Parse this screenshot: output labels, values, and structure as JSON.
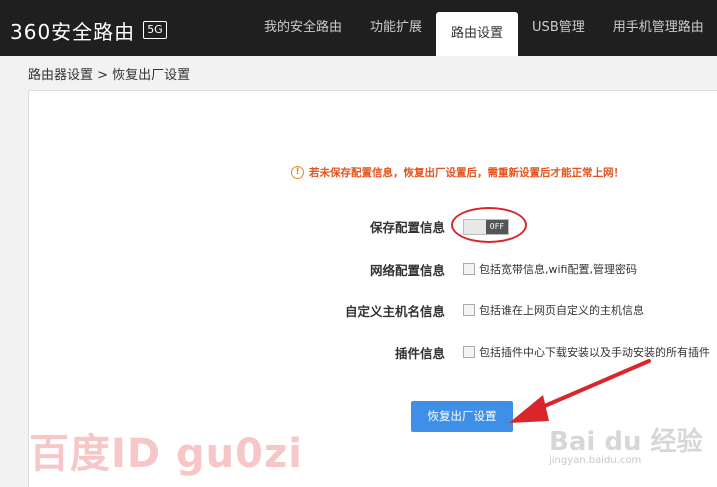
{
  "header": {
    "logo_text": "360安全路由",
    "logo_badge": "5G",
    "nav": [
      {
        "label": "我的安全路由"
      },
      {
        "label": "功能扩展"
      },
      {
        "label": "路由设置",
        "active": true
      },
      {
        "label": "USB管理"
      },
      {
        "label": "用手机管理路由"
      }
    ]
  },
  "breadcrumb": {
    "text": "路由器设置 > 恢复出厂设置"
  },
  "main": {
    "warning": "若未保存配置信息，恢复出厂设置后，需重新设置后才能正常上网！",
    "rows": [
      {
        "label": "保存配置信息",
        "toggle_state": "OFF"
      },
      {
        "label": "网络配置信息",
        "description": "包括宽带信息,wifi配置,管理密码",
        "checked": false
      },
      {
        "label": "自定义主机名信息",
        "description": "包括谁在上网页自定义的主机信息",
        "checked": false
      },
      {
        "label": "插件信息",
        "description": "包括插件中心下载安装以及手动安装的所有插件",
        "checked": false
      }
    ],
    "reset_button": "恢复出厂设置"
  },
  "watermarks": {
    "left": "百度ID gu0zi",
    "right": "Bai du 经验",
    "right_sub": "jingyan.baidu.com"
  },
  "colors": {
    "header_bg": "#1f1f1f",
    "warning": "#e4541d",
    "button": "#3d8fe8",
    "annotation": "#d9262a"
  }
}
